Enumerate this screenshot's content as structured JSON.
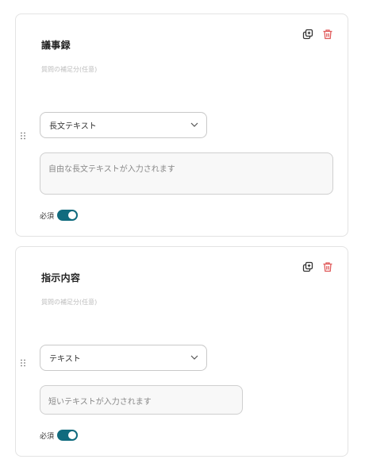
{
  "questions": [
    {
      "title": "議事録",
      "description": "質問の補足分(任意)",
      "type_label": "長文テキスト",
      "answer_placeholder": "自由な長文テキストが入力されます",
      "required_label": "必須",
      "required": true
    },
    {
      "title": "指示内容",
      "description": "質問の補足分(任意)",
      "type_label": "テキスト",
      "answer_placeholder": "短いテキストが入力されます",
      "required_label": "必須",
      "required": true
    }
  ],
  "icons": {
    "copy": "copy-icon",
    "delete": "trash-icon",
    "drag": "drag-handle-icon",
    "select": "chevron-down-icon"
  },
  "colors": {
    "toggle_on": "#106b7e",
    "delete_icon": "#e05a5a"
  }
}
